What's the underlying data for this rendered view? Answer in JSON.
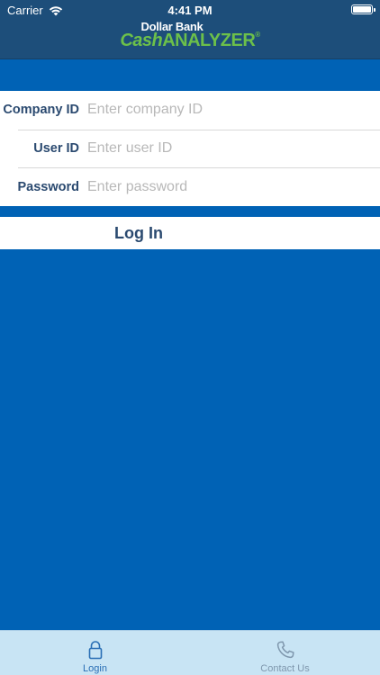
{
  "status_bar": {
    "carrier": "Carrier",
    "time": "4:41 PM"
  },
  "header": {
    "logo_top": "Dollar Bank",
    "logo_cash": "Cash",
    "logo_analyzer": "ANALYZER",
    "logo_mark": "®"
  },
  "form": {
    "company_id": {
      "label": "Company ID",
      "placeholder": "Enter company ID",
      "value": ""
    },
    "user_id": {
      "label": "User ID",
      "placeholder": "Enter user ID",
      "value": ""
    },
    "password": {
      "label": "Password",
      "placeholder": "Enter password",
      "value": ""
    }
  },
  "login_button": {
    "label": "Log In"
  },
  "tabbar": {
    "tabs": [
      {
        "label": "Login",
        "icon": "lock-icon",
        "active": true
      },
      {
        "label": "Contact Us",
        "icon": "phone-icon",
        "active": false
      }
    ]
  },
  "colors": {
    "header_bg": "#1d4e7a",
    "page_bg": "#0062b5",
    "label_text": "#2b4a70",
    "brand_green": "#6cc04a",
    "tab_active": "#2a6fb5",
    "tab_inactive": "#7f97ad",
    "tabbar_bg": "#c8e4f4"
  }
}
